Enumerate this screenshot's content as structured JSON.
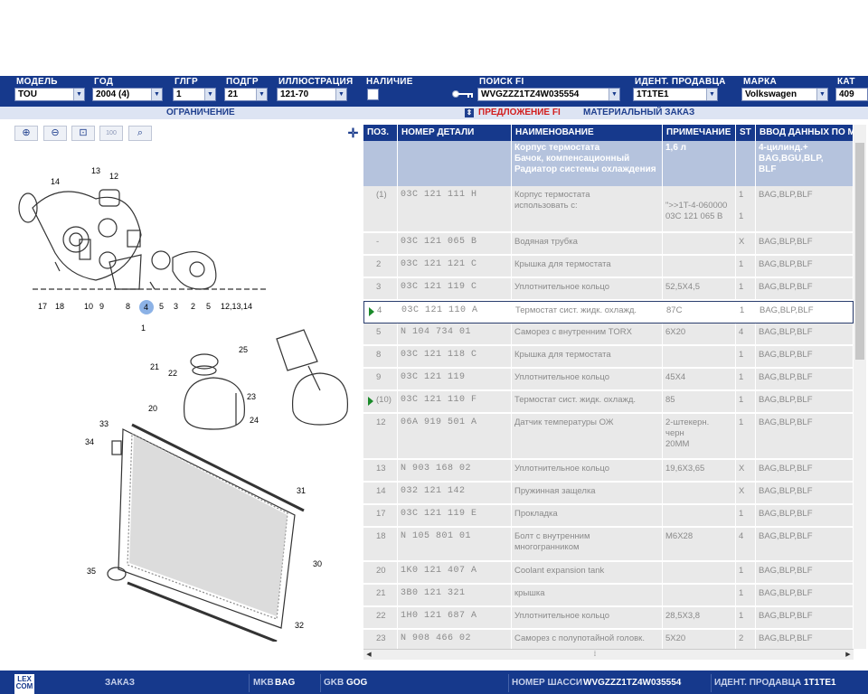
{
  "header": {
    "model": {
      "label": "МОДЕЛЬ",
      "value": "TOU"
    },
    "year": {
      "label": "ГОД",
      "value": "2004 (4)"
    },
    "glgr": {
      "label": "ГЛГР",
      "value": "1"
    },
    "podgr": {
      "label": "ПОДГР",
      "value": "21"
    },
    "illustration": {
      "label": "ИЛЛЮСТРАЦИЯ",
      "value": "121-70"
    },
    "availability": {
      "label": "НАЛИЧИЕ"
    },
    "search": {
      "label": "ПОИСК FI",
      "value": "WVGZZZ1TZ4W035554"
    },
    "dealer": {
      "label": "ИДЕНТ. ПРОДАВЦА",
      "value": "1T1TE1"
    },
    "brand": {
      "label": "МАРКА",
      "value": "Volkswagen"
    },
    "cat": {
      "label": "КАТ",
      "value": "409"
    }
  },
  "subbar": {
    "restriction": "ОГРАНИЧЕНИЕ",
    "fi_offer": "ПРЕДЛОЖЕНИЕ FI",
    "material_order": "МАТЕРИАЛЬНЫЙ ЗАКАЗ"
  },
  "toolbar": {
    "zoom_in": "⊕",
    "zoom_out": "⊖",
    "zoom_area": "⊡",
    "zoom_fit": "100",
    "search": "⌕",
    "move": "✛"
  },
  "diagram": {
    "labels": [
      "14",
      "13",
      "12",
      "17",
      "18",
      "10",
      "9",
      "8",
      "4",
      "5",
      "3",
      "2",
      "5",
      "12,13,14",
      "1",
      "25",
      "21",
      "22",
      "20",
      "23",
      "24",
      "33",
      "34",
      "31",
      "30",
      "35",
      "32"
    ]
  },
  "table": {
    "headers": [
      "ПОЗ.",
      "НОМЕР ДЕТАЛИ",
      "НАИМЕНОВАНИЕ",
      "ПРИМЕЧАНИЕ",
      "ST",
      "ВВОД ДАННЫХ ПО М"
    ],
    "top": {
      "name": "Корпус термостата\nБачок, компенсационный\nРадиатор системы охлаждения",
      "note": "1,6 л",
      "data": "4-цилинд.+\nBAG,BGU,BLP,\nBLF"
    },
    "rows": [
      {
        "pos": "(1)",
        "part": "03C 121 111 H",
        "name": "Корпус термостата\n            использовать с:",
        "note": "\n\">>1T-4-060000\n03C 121 065 B",
        "st": "1\n\n1",
        "data": "BAG,BLP,BLF",
        "h": 52
      },
      {
        "pos": "-",
        "part": "03C 121 065 B",
        "name": "Водяная трубка",
        "note": "",
        "st": "X",
        "data": "BAG,BLP,BLF",
        "h": 25
      },
      {
        "pos": "2",
        "part": "03C 121 121 C",
        "name": "Крышка для термостата",
        "note": "",
        "st": "1",
        "data": "BAG,BLP,BLF",
        "h": 25
      },
      {
        "pos": "3",
        "part": "03C 121 119 C",
        "name": "Уплотнительное кольцо",
        "note": "52,5X4,5",
        "st": "1",
        "data": "BAG,BLP,BLF",
        "h": 25
      },
      {
        "pos": "4",
        "part": "03C 121 110 A",
        "name": "Термостат сист. жидк. охлажд.",
        "note": "87C",
        "st": "1",
        "data": "BAG,BLP,BLF",
        "h": 25,
        "arrow": true,
        "selected": true
      },
      {
        "pos": "5",
        "part": "N  104 734 01",
        "name": "Саморез с внутренним TORX",
        "note": "6X20",
        "st": "4",
        "data": "BAG,BLP,BLF",
        "h": 25
      },
      {
        "pos": "8",
        "part": "03C 121 118 C",
        "name": "Крышка для термостата",
        "note": "",
        "st": "1",
        "data": "BAG,BLP,BLF",
        "h": 25
      },
      {
        "pos": "9",
        "part": "03C 121 119",
        "name": "Уплотнительное кольцо",
        "note": "45X4",
        "st": "1",
        "data": "BAG,BLP,BLF",
        "h": 25
      },
      {
        "pos": "(10)",
        "part": "03C 121 110 F",
        "name": "Термостат сист. жидк. охлажд.",
        "note": "85",
        "st": "1",
        "data": "BAG,BLP,BLF",
        "h": 25,
        "arrow": true
      },
      {
        "pos": "12",
        "part": "06A 919 501 A",
        "name": "Датчик температуры ОЖ",
        "note": "2-штекерн.\nчерн\n20MM",
        "st": "1",
        "data": "BAG,BLP,BLF",
        "h": 51
      },
      {
        "pos": "13",
        "part": "N  903 168 02",
        "name": "Уплотнительное кольцо",
        "note": "19,6X3,65",
        "st": "X",
        "data": "BAG,BLP,BLF",
        "h": 25
      },
      {
        "pos": "14",
        "part": "032 121 142",
        "name": "Пружинная защелка",
        "note": "",
        "st": "X",
        "data": "BAG,BLP,BLF",
        "h": 25
      },
      {
        "pos": "17",
        "part": "03C 121 119 E",
        "name": "Прокладка",
        "note": "",
        "st": "1",
        "data": "BAG,BLP,BLF",
        "h": 25
      },
      {
        "pos": "18",
        "part": "N  105 801 01",
        "name": "Болт с внутренним\nмногогранником",
        "note": "M6X28",
        "st": "4",
        "data": "BAG,BLP,BLF",
        "h": 38
      },
      {
        "pos": "20",
        "part": "1K0 121 407 A",
        "name": "Coolant expansion tank",
        "note": "",
        "st": "1",
        "data": "BAG,BLP,BLF",
        "h": 25
      },
      {
        "pos": "21",
        "part": "3B0 121 321",
        "name": "крышка",
        "note": "",
        "st": "1",
        "data": "BAG,BLP,BLF",
        "h": 25
      },
      {
        "pos": "22",
        "part": "1H0 121 687 A",
        "name": "Уплотнительное кольцо",
        "note": "28,5X3,8",
        "st": "1",
        "data": "BAG,BLP,BLF",
        "h": 25
      },
      {
        "pos": "23",
        "part": "N  908 466 02",
        "name": "Саморез с полупотайной головк.",
        "note": "5X20",
        "st": "2",
        "data": "BAG,BLP,BLF",
        "h": 25
      }
    ]
  },
  "footer": {
    "order": "ЗАКАЗ",
    "mkb_label": "MKB",
    "mkb": "BAG",
    "gkb_label": "GKB",
    "gkb": "GOG",
    "chassis_label": "НОМЕР ШАССИ",
    "chassis": "WVGZZZ1TZ4W035554",
    "dealer_label": "ИДЕНТ. ПРОДАВЦА",
    "dealer": "1T1TE1",
    "logo": "LEX\nCOM"
  },
  "colors": {
    "header": "#16398c",
    "row": "#e9e9e9",
    "accent": "#d21f1f"
  }
}
